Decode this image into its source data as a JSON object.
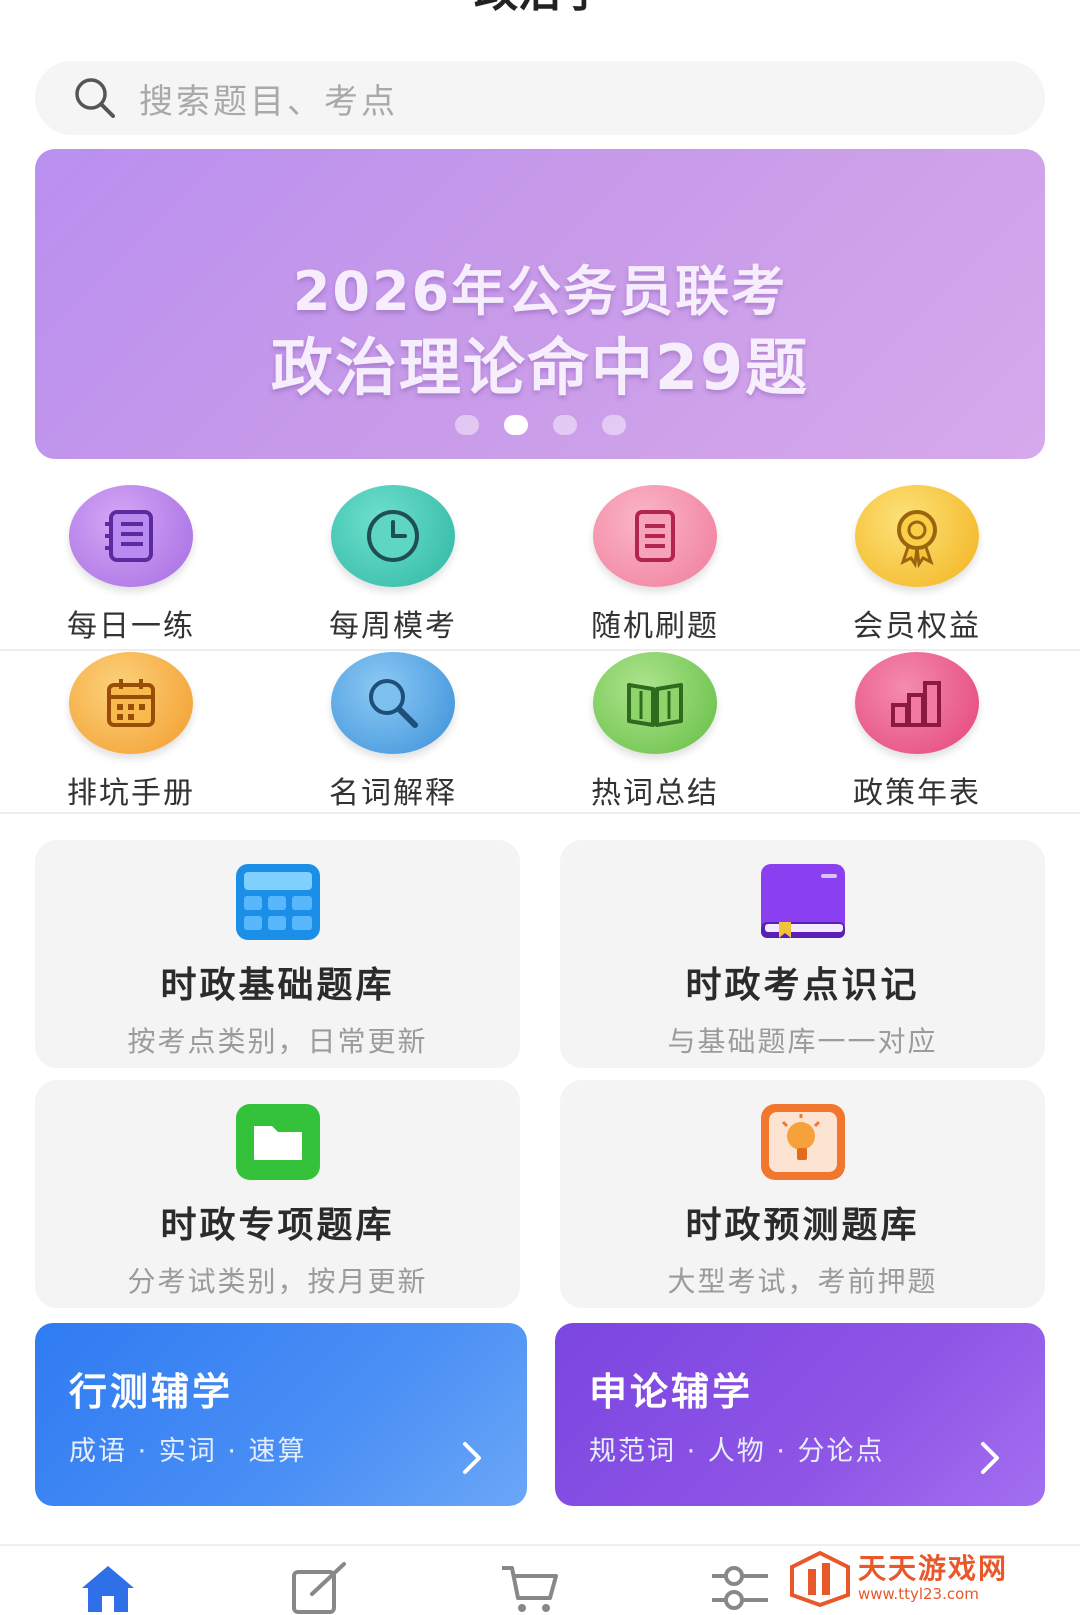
{
  "page": {
    "title": "政治学"
  },
  "search": {
    "placeholder": "搜索题目、考点"
  },
  "banner": {
    "line1": "2026年公务员联考",
    "line2": "政治理论命中29题",
    "slide_count": 4,
    "active_slide": 2
  },
  "features": [
    {
      "label": "每日一练",
      "icon": "notebook-icon",
      "color": "#b07be8"
    },
    {
      "label": "每周模考",
      "icon": "clock-icon",
      "color": "#3ec8b4"
    },
    {
      "label": "随机刷题",
      "icon": "document-icon",
      "color": "#f58fab"
    },
    {
      "label": "会员权益",
      "icon": "medal-icon",
      "color": "#f5c43a"
    },
    {
      "label": "排坑手册",
      "icon": "calendar-icon",
      "color": "#f7b24a"
    },
    {
      "label": "名词解释",
      "icon": "magnifier-icon",
      "color": "#4aa3e6"
    },
    {
      "label": "热词总结",
      "icon": "open-book-icon",
      "color": "#7ccf5a"
    },
    {
      "label": "政策年表",
      "icon": "bar-chart-icon",
      "color": "#ee5d8c"
    }
  ],
  "cards": [
    {
      "title": "时政基础题库",
      "subtitle": "按考点类别，日常更新",
      "icon": "calculator-icon"
    },
    {
      "title": "时政考点识记",
      "subtitle": "与基础题库一一对应",
      "icon": "book-icon"
    },
    {
      "title": "时政专项题库",
      "subtitle": "分考试类别，按月更新",
      "icon": "folder-icon"
    },
    {
      "title": "时政预测题库",
      "subtitle": "大型考试，考前押题",
      "icon": "lightbulb-icon"
    }
  ],
  "promos": [
    {
      "title": "行测辅学",
      "subtitle": "成语 · 实词 · 速算"
    },
    {
      "title": "申论辅学",
      "subtitle": "规范词 · 人物 · 分论点"
    }
  ],
  "tabbar": {
    "accent": "#2f6fe8",
    "tabs": [
      "home-icon",
      "edit-icon",
      "cart-icon",
      "settings-sliders-icon"
    ]
  },
  "watermark": {
    "name": "天天游戏网",
    "url": "www.ttyl23.com"
  }
}
